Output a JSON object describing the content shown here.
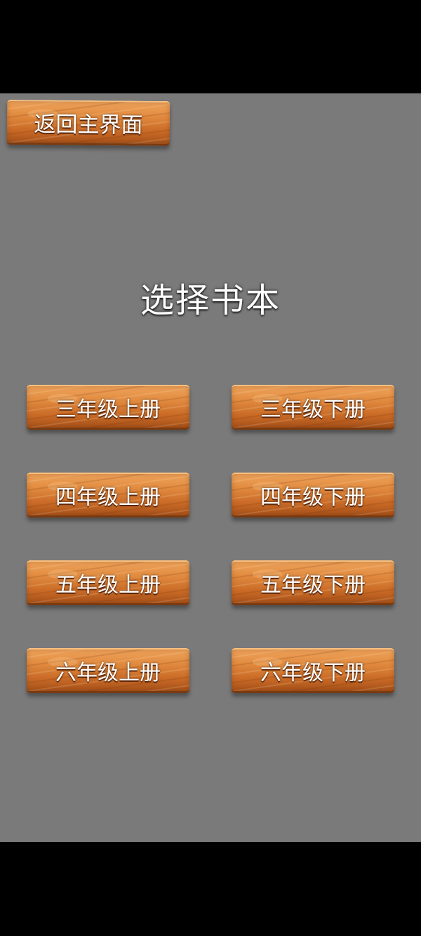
{
  "back_button": {
    "label": "返回主界面"
  },
  "title": "选择书本",
  "books": [
    {
      "left": "三年级上册",
      "right": "三年级下册"
    },
    {
      "left": "四年级上册",
      "right": "四年级下册"
    },
    {
      "left": "五年级上册",
      "right": "五年级下册"
    },
    {
      "left": "六年级上册",
      "right": "六年级下册"
    }
  ],
  "colors": {
    "background": "#7a7a7a",
    "letterbox": "#000000",
    "wood": "#e08a3f",
    "text": "#ffffff"
  }
}
